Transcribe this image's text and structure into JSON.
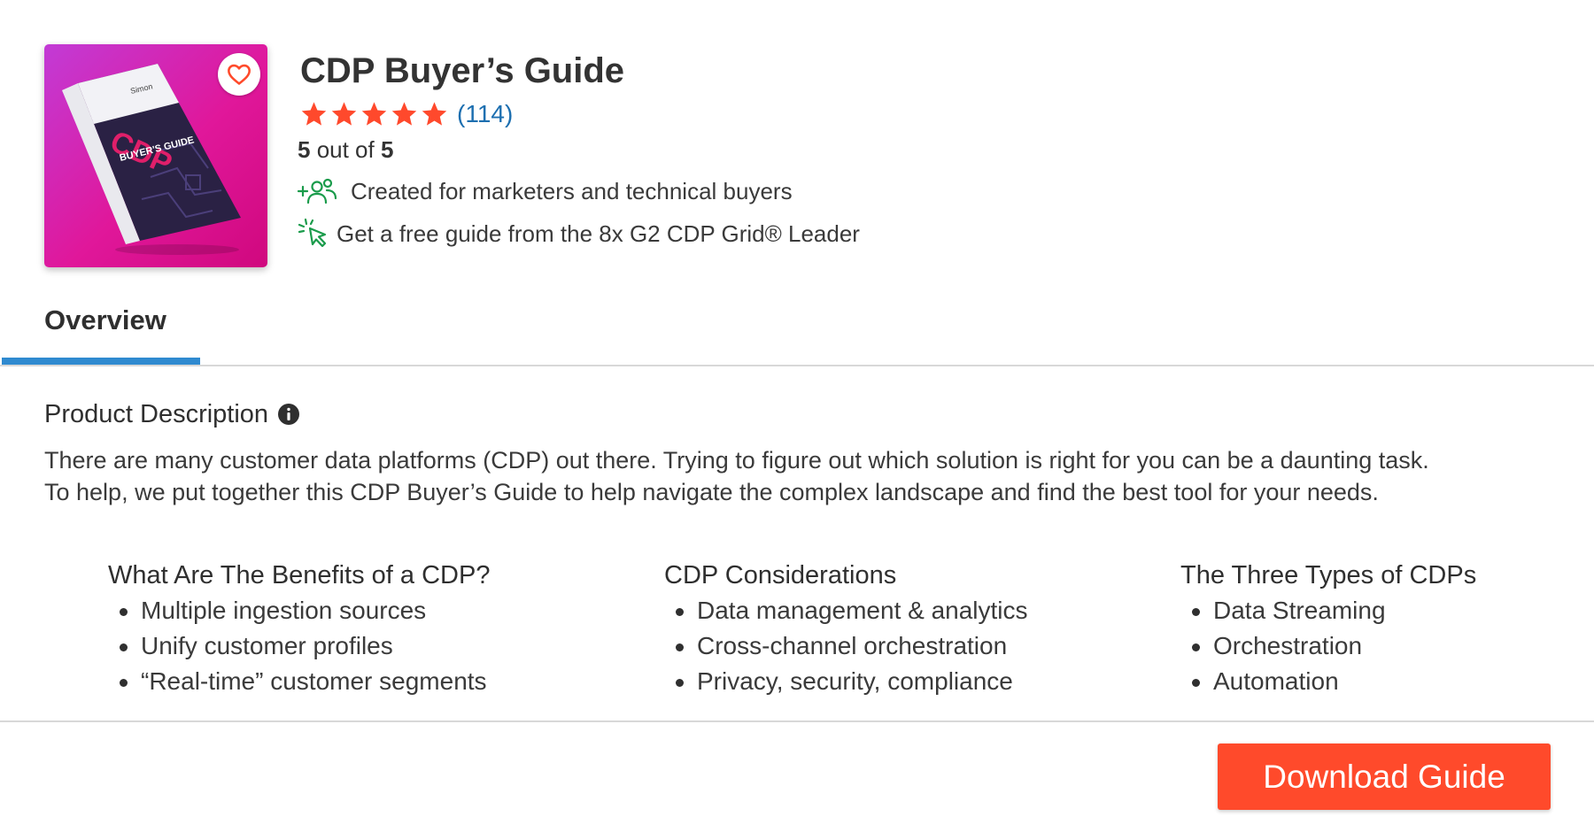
{
  "product": {
    "title": "CDP Buyer’s Guide",
    "cover": {
      "brand": "Simon",
      "headline": "CDP",
      "subtitle": "BUYER'S GUIDE",
      "gradient": [
        "#c23bd6",
        "#d0087e"
      ]
    },
    "rating": {
      "stars": 5,
      "max_stars": 5,
      "count_label": "(114)",
      "score_value": "5",
      "score_middle": " out of ",
      "score_max": "5",
      "star_color": "#ff492c"
    },
    "features": [
      {
        "icon": "user-add-icon",
        "text": "Created for marketers and technical buyers"
      },
      {
        "icon": "cursor-click-icon",
        "text": "Get a free guide from the 8x G2 CDP Grid® Leader"
      }
    ]
  },
  "tabs": [
    {
      "label": "Overview",
      "active": true
    }
  ],
  "description": {
    "heading": "Product Description",
    "lines": [
      "There are many customer data platforms (CDP) out there. Trying to figure out which solution is right for you can be a daunting task.",
      "To help, we put together this CDP Buyer’s Guide to help navigate the complex landscape and find the best tool for your needs."
    ]
  },
  "columns": [
    {
      "heading": "What Are The Benefits of a CDP?",
      "items": [
        "Multiple ingestion sources",
        "Unify customer profiles",
        "“Real-time” customer segments"
      ]
    },
    {
      "heading": "CDP Considerations",
      "items": [
        "Data management & analytics",
        "Cross-channel orchestration",
        "Privacy, security, compliance"
      ]
    },
    {
      "heading": "The Three Types of CDPs",
      "items": [
        "Data Streaming",
        "Orchestration",
        "Automation"
      ]
    }
  ],
  "cta": {
    "label": "Download Guide",
    "color": "#ff4a2b"
  },
  "colors": {
    "accent_tab": "#2f8ad0",
    "link": "#1d6fb0",
    "feature_icon": "#1a9b4b",
    "favorite_icon": "#ff4a2b"
  }
}
